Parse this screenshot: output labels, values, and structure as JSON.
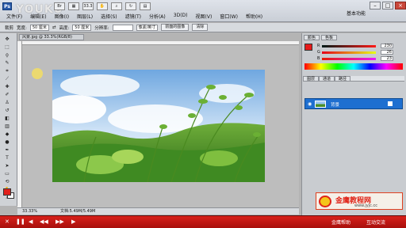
{
  "app": {
    "logo": "Ps",
    "watermark": "YOUKU",
    "workspace_label": "基本功能"
  },
  "menu": [
    "文件(F)",
    "编辑(E)",
    "图像(I)",
    "图层(L)",
    "选择(S)",
    "滤镜(T)",
    "分析(A)",
    "3D(D)",
    "视图(V)",
    "窗口(W)",
    "帮助(H)"
  ],
  "options_bar": {
    "tool": "裁剪",
    "width_label": "宽度:",
    "width_value": "50 厘米",
    "height_label": "高度:",
    "height_value": "50 厘米",
    "resolution_label": "分辨率:",
    "resolution_unit": "像素/英寸",
    "front_image_button": "前面的图像",
    "clear_button": "清除"
  },
  "document": {
    "tab_title": "风景.jpg @ 33.3%(RGB/8)",
    "zoom": "33.33%",
    "doc_size": "文档:5.49M/5.49M"
  },
  "color_panel": {
    "tabs": [
      "颜色",
      "色板"
    ],
    "fg_color": "#e61a1a",
    "channels": [
      {
        "label": "R",
        "value": "230"
      },
      {
        "label": "G",
        "value": "26"
      },
      {
        "label": "B",
        "value": "23"
      }
    ]
  },
  "layers_panel": {
    "tabs": [
      "图层",
      "通道",
      "路径"
    ],
    "layer_name": "背景"
  },
  "brand": {
    "name": "金鹰教程网",
    "url": "www.jyjc.cc"
  },
  "player": {
    "help_label": "金鹰帮助",
    "chat_label": "互动交流"
  }
}
